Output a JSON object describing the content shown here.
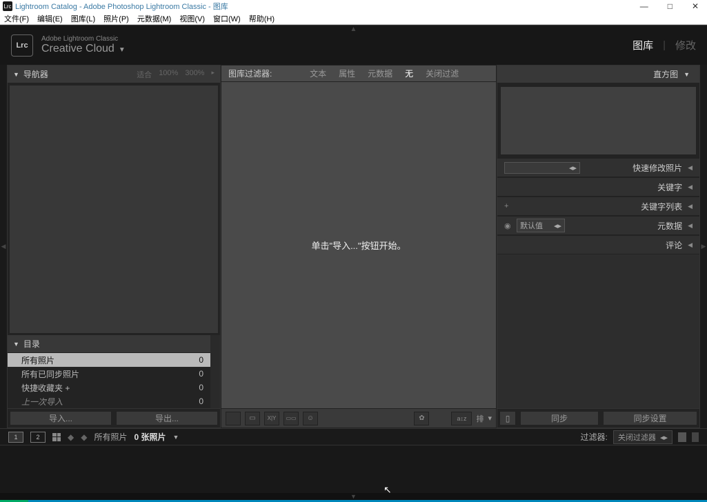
{
  "window": {
    "title": "Lightroom Catalog - Adobe Photoshop Lightroom Classic - 图库",
    "icon_text": "Lrc"
  },
  "menubar": [
    "文件(F)",
    "编辑(E)",
    "图库(L)",
    "照片(P)",
    "元数据(M)",
    "视图(V)",
    "窗口(W)",
    "帮助(H)"
  ],
  "brand": {
    "line1": "Adobe Lightroom Classic",
    "line2": "Creative Cloud"
  },
  "modules": {
    "active": "图库",
    "inactive": "修改"
  },
  "navigator": {
    "title": "导航器",
    "fit": "适合",
    "p100": "100%",
    "p300": "300%"
  },
  "catalog": {
    "title": "目录",
    "items": [
      {
        "label": "所有照片",
        "count": "0",
        "selected": true
      },
      {
        "label": "所有已同步照片",
        "count": "0"
      },
      {
        "label": "快捷收藏夹 +",
        "count": "0"
      },
      {
        "label": "上一次导入",
        "count": "0"
      }
    ]
  },
  "left_buttons": {
    "import": "导入...",
    "export": "导出..."
  },
  "filter_bar": {
    "label": "图库过滤器:",
    "text": "文本",
    "attr": "属性",
    "meta": "元数据",
    "none": "无",
    "close": "关闭过滤"
  },
  "center_hint": "单击\"导入...\"按钮开始。",
  "toolbar": {
    "sort": "排"
  },
  "histogram": {
    "title": "直方图"
  },
  "right_sections": {
    "quickdev": "快速修改照片",
    "keywords": "关键字",
    "keywordlist": "关键字列表",
    "metadata": "元数据",
    "metadata_preset": "默认值",
    "comments": "评论"
  },
  "right_buttons": {
    "sync": "同步",
    "sync_settings": "同步设置"
  },
  "secondbar": {
    "all_photos": "所有照片",
    "count": "0 张照片",
    "filter_label": "过滤器:",
    "filter_value": "关闭过滤器"
  }
}
